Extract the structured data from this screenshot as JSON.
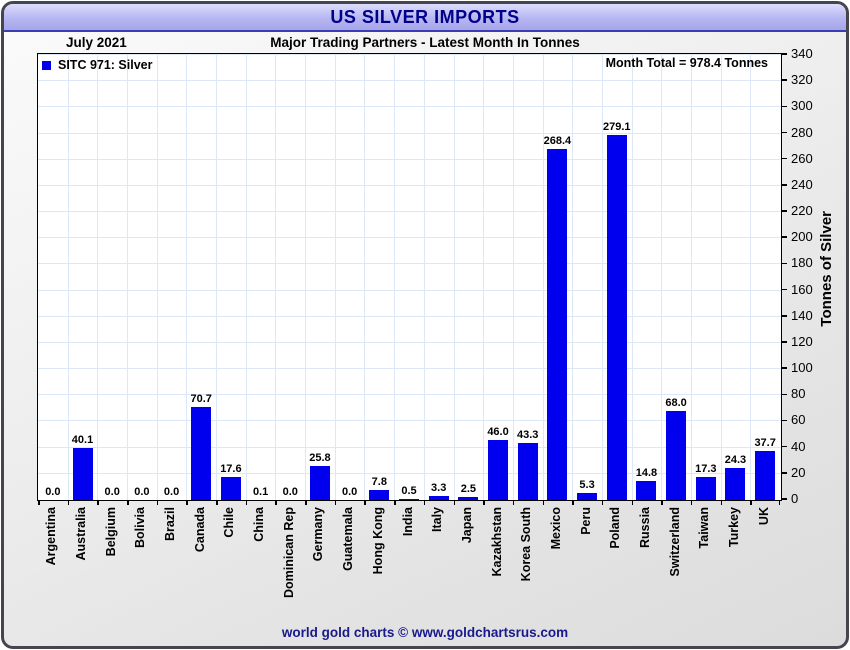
{
  "header": {
    "title": "US SILVER IMPORTS",
    "period": "July 2021",
    "subtitle": "Major Trading Partners - Latest Month In Tonnes"
  },
  "legend": {
    "label": "SITC 971: Silver",
    "swatch_color": "#0000ee"
  },
  "annotations": {
    "month_total": "Month Total = 978.4 Tonnes"
  },
  "footer": {
    "credit": "world gold charts © www.goldchartsrus.com"
  },
  "colors": {
    "bar": "#0000ee",
    "grid": "#dce8f6",
    "title_text": "#00008b",
    "footer_text": "#19198c",
    "titlebar_fill": "#b6b6f2"
  },
  "chart_data": {
    "type": "bar",
    "title": "US SILVER IMPORTS",
    "subtitle": "Major Trading Partners - Latest Month In Tonnes",
    "period": "July 2021",
    "categories": [
      "Argentina",
      "Australia",
      "Belgium",
      "Bolivia",
      "Brazil",
      "Canada",
      "Chile",
      "China",
      "Dominican Rep",
      "Germany",
      "Guatemala",
      "Hong Kong",
      "India",
      "Italy",
      "Japan",
      "Kazakhstan",
      "Korea South",
      "Mexico",
      "Peru",
      "Poland",
      "Russia",
      "Switzerland",
      "Taiwan",
      "Turkey",
      "UK"
    ],
    "values": [
      0.0,
      40.1,
      0.0,
      0.0,
      0.0,
      70.7,
      17.6,
      0.1,
      0.0,
      25.8,
      0.0,
      7.8,
      0.5,
      3.3,
      2.5,
      46.0,
      43.3,
      268.4,
      5.3,
      279.1,
      14.8,
      68.0,
      17.3,
      24.3,
      37.7
    ],
    "series_name": "SITC 971: Silver",
    "xlabel": "",
    "ylabel": "Tonnes of Silver",
    "ylim": [
      0,
      340
    ],
    "ytick_step": 20,
    "yticks": [
      0,
      20,
      40,
      60,
      80,
      100,
      120,
      140,
      160,
      180,
      200,
      220,
      240,
      260,
      280,
      300,
      320,
      340
    ],
    "grid": true,
    "legend_position": "top-left",
    "month_total": 978.4
  }
}
